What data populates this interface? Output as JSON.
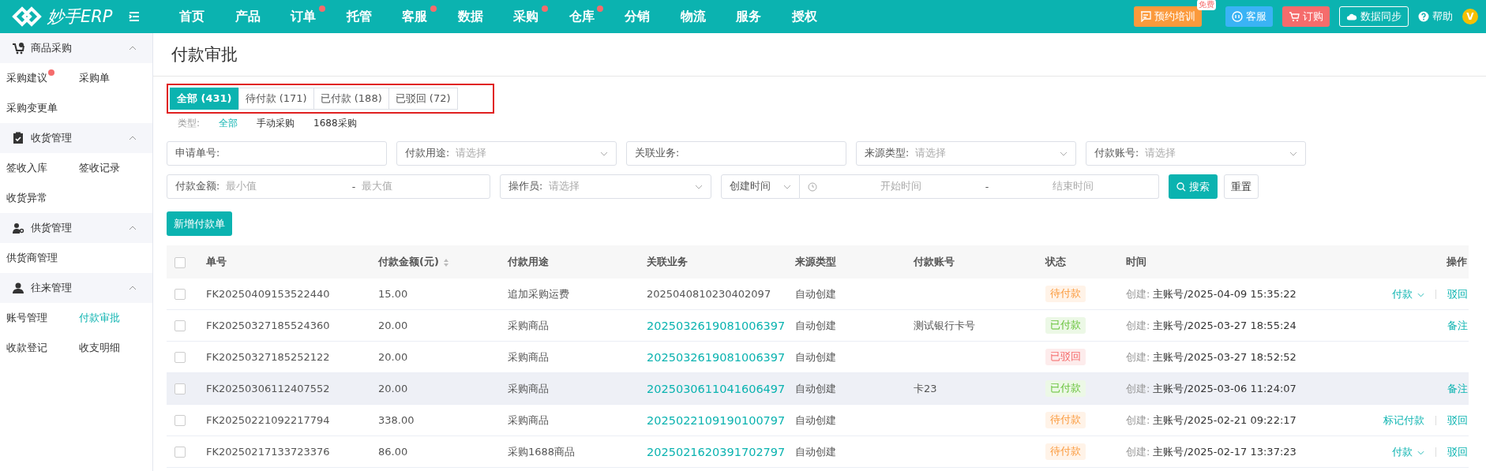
{
  "brand": {
    "name": "妙手ERP"
  },
  "nav": [
    {
      "label": "首页",
      "badge": false
    },
    {
      "label": "产品",
      "badge": false
    },
    {
      "label": "订单",
      "badge": true
    },
    {
      "label": "托管",
      "badge": false
    },
    {
      "label": "客服",
      "badge": true
    },
    {
      "label": "数据",
      "badge": false
    },
    {
      "label": "采购",
      "badge": true
    },
    {
      "label": "仓库",
      "badge": true
    },
    {
      "label": "分销",
      "badge": false
    },
    {
      "label": "物流",
      "badge": false
    },
    {
      "label": "服务",
      "badge": false
    },
    {
      "label": "授权",
      "badge": false
    }
  ],
  "header_actions": [
    {
      "kind": "training",
      "label": "预约培训",
      "tag": "免费"
    },
    {
      "kind": "service",
      "label": "客服"
    },
    {
      "kind": "order",
      "label": "订购"
    },
    {
      "kind": "sync",
      "label": "数据同步"
    },
    {
      "kind": "help",
      "label": "帮助"
    }
  ],
  "avatar": {
    "letter": "V"
  },
  "sidebar": [
    {
      "title": "商品采购",
      "expanded": true,
      "items": [
        {
          "label": "采购建议",
          "badge": true,
          "selected": false
        },
        {
          "label": "采购单",
          "badge": false,
          "selected": false
        },
        {
          "label": "采购变更单",
          "badge": false,
          "selected": false
        }
      ]
    },
    {
      "title": "收货管理",
      "expanded": true,
      "items": [
        {
          "label": "签收入库",
          "badge": false,
          "selected": false
        },
        {
          "label": "签收记录",
          "badge": false,
          "selected": false
        },
        {
          "label": "收货异常",
          "badge": false,
          "selected": false
        }
      ]
    },
    {
      "title": "供货管理",
      "expanded": true,
      "items": [
        {
          "label": "供货商管理",
          "badge": false,
          "selected": false
        }
      ]
    },
    {
      "title": "往来管理",
      "expanded": true,
      "items": [
        {
          "label": "账号管理",
          "badge": false,
          "selected": false
        },
        {
          "label": "付款审批",
          "badge": false,
          "selected": true
        },
        {
          "label": "收款登记",
          "badge": false,
          "selected": false
        },
        {
          "label": "收支明细",
          "badge": false,
          "selected": false
        }
      ]
    }
  ],
  "page_title": "付款审批",
  "tabs_outlined": true,
  "tabs": [
    {
      "label": "全部 (431)",
      "selected": true
    },
    {
      "label": "待付款 (171)",
      "selected": false
    },
    {
      "label": "已付款 (188)",
      "selected": false
    },
    {
      "label": "已驳回 (72)",
      "selected": false
    }
  ],
  "type_filter": {
    "label": "类型:",
    "options": [
      {
        "label": "全部",
        "selected": true
      },
      {
        "label": "手动采购",
        "selected": false
      },
      {
        "label": "1688采购",
        "selected": false
      }
    ]
  },
  "filter_rows": [
    [
      {
        "kind": "text",
        "label": "申请单号:"
      },
      {
        "kind": "select",
        "label": "付款用途:",
        "placeholder": "请选择"
      },
      {
        "kind": "text",
        "label": "关联业务:"
      },
      {
        "kind": "select",
        "label": "来源类型:",
        "placeholder": "请选择"
      },
      {
        "kind": "select",
        "label": "付款账号:",
        "placeholder": "请选择"
      }
    ],
    [
      {
        "kind": "range",
        "label": "付款金额:",
        "placeholder": "最小值",
        "separator": "-",
        "placeholder_end": "最大值"
      },
      {
        "kind": "select",
        "label": "操作员:",
        "placeholder": "请选择"
      },
      {
        "kind": "daterange",
        "label": "创建时间",
        "placeholder": "开始时间",
        "separator": "-",
        "placeholder_end": "结束时间"
      }
    ]
  ],
  "search_button": "搜索",
  "reset_button": "重置",
  "add_button": "新增付款单",
  "table": {
    "all_checked": false,
    "columns": [
      "单号",
      "付款金额(元)",
      "付款用途",
      "关联业务",
      "来源类型",
      "付款账号",
      "状态",
      "时间",
      "操作"
    ],
    "rows": [
      {
        "checked": false,
        "hovered": false,
        "no": "FK20250409153522440",
        "amount": "15.00",
        "purpose": "追加采购运费",
        "related": "2025040810230402097",
        "related_link": false,
        "source": "自动创建",
        "account": "",
        "status": {
          "kind": "pending",
          "label": "待付款"
        },
        "time_label": "创建:",
        "time": "主账号/2025-04-09 15:35:22",
        "actions": [
          {
            "kind": "dropdown",
            "label": "付款"
          },
          {
            "kind": "link",
            "label": "驳回"
          }
        ]
      },
      {
        "checked": false,
        "hovered": false,
        "no": "FK20250327185524360",
        "amount": "20.00",
        "purpose": "采购商品",
        "related": "2025032619081006397",
        "related_link": true,
        "source": "自动创建",
        "account": "测试银行卡号",
        "status": {
          "kind": "paid",
          "label": "已付款"
        },
        "time_label": "创建:",
        "time": "主账号/2025-03-27 18:55:24",
        "actions": [
          {
            "kind": "link",
            "label": "备注"
          }
        ]
      },
      {
        "checked": false,
        "hovered": false,
        "no": "FK20250327185252122",
        "amount": "20.00",
        "purpose": "采购商品",
        "related": "2025032619081006397",
        "related_link": true,
        "source": "自动创建",
        "account": "",
        "status": {
          "kind": "rejected",
          "label": "已驳回"
        },
        "time_label": "创建:",
        "time": "主账号/2025-03-27 18:52:52",
        "actions": []
      },
      {
        "checked": false,
        "hovered": true,
        "no": "FK20250306112407552",
        "amount": "20.00",
        "purpose": "采购商品",
        "related": "2025030611041606497",
        "related_link": true,
        "source": "自动创建",
        "account": "卡23",
        "status": {
          "kind": "paid",
          "label": "已付款"
        },
        "time_label": "创建:",
        "time": "主账号/2025-03-06 11:24:07",
        "actions": [
          {
            "kind": "link",
            "label": "备注"
          }
        ]
      },
      {
        "checked": false,
        "hovered": false,
        "no": "FK20250221092217794",
        "amount": "338.00",
        "purpose": "采购商品",
        "related": "2025022109190100797",
        "related_link": true,
        "source": "自动创建",
        "account": "",
        "status": {
          "kind": "pending",
          "label": "待付款"
        },
        "time_label": "创建:",
        "time": "主账号/2025-02-21 09:22:17",
        "actions": [
          {
            "kind": "link",
            "label": "标记付款"
          },
          {
            "kind": "link",
            "label": "驳回"
          }
        ]
      },
      {
        "checked": false,
        "hovered": false,
        "no": "FK20250217133723376",
        "amount": "86.00",
        "purpose": "采购1688商品",
        "related": "2025021620391702797",
        "related_link": true,
        "source": "自动创建",
        "account": "",
        "status": {
          "kind": "pending",
          "label": "待付款"
        },
        "time_label": "创建:",
        "time": "主账号/2025-02-17 13:37:23",
        "actions": [
          {
            "kind": "dropdown",
            "label": "付款"
          },
          {
            "kind": "link",
            "label": "驳回"
          }
        ]
      }
    ]
  }
}
